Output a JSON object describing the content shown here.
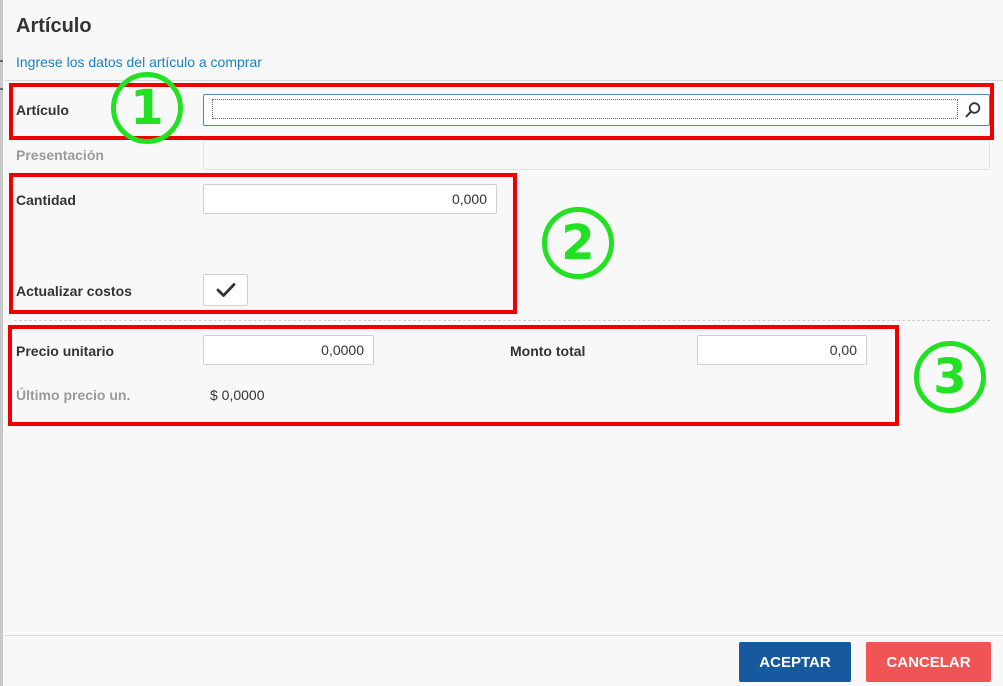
{
  "dialog": {
    "title": "Artículo",
    "subtitle": "Ingrese los datos del artículo a comprar"
  },
  "form": {
    "articulo": {
      "label": "Artículo",
      "value": ""
    },
    "presentacion": {
      "label": "Presentación",
      "value": ""
    },
    "cantidad": {
      "label": "Cantidad",
      "value": "0,000"
    },
    "actualizar_costos": {
      "label": "Actualizar costos",
      "checked": true
    },
    "precio_unitario": {
      "label": "Precio unitario",
      "value": "0,0000"
    },
    "monto_total": {
      "label": "Monto total",
      "value": "0,00"
    },
    "ultimo_precio": {
      "label": "Último precio un.",
      "value": "$ 0,0000"
    }
  },
  "buttons": {
    "accept": "ACEPTAR",
    "cancel": "CANCELAR"
  },
  "annotations": {
    "callouts": [
      "1",
      "2",
      "3"
    ],
    "box_color": "#ee0000",
    "callout_color": "#22e022"
  },
  "icons": {
    "search": "search-icon",
    "check": "check-icon"
  },
  "colors": {
    "accent": "#17599f",
    "danger": "#f05454",
    "link": "#1a80c4"
  }
}
